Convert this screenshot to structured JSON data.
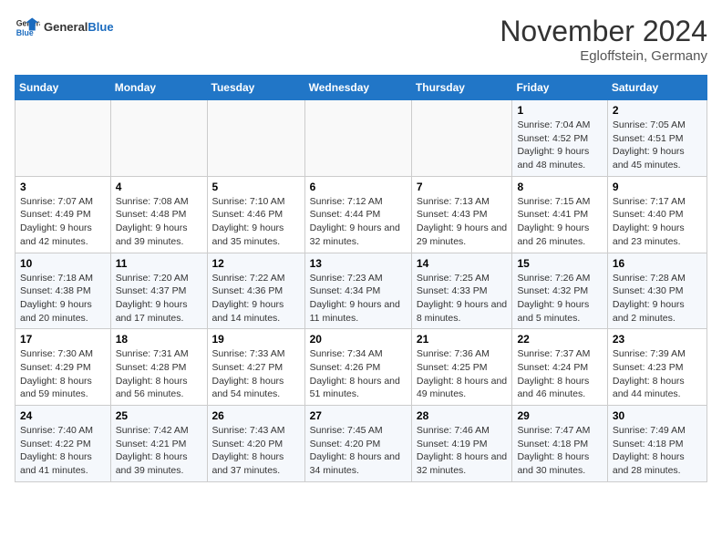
{
  "header": {
    "logo_general": "General",
    "logo_blue": "Blue",
    "month_year": "November 2024",
    "location": "Egloffstein, Germany"
  },
  "weekdays": [
    "Sunday",
    "Monday",
    "Tuesday",
    "Wednesday",
    "Thursday",
    "Friday",
    "Saturday"
  ],
  "weeks": [
    [
      {
        "day": "",
        "sunrise": "",
        "sunset": "",
        "daylight": ""
      },
      {
        "day": "",
        "sunrise": "",
        "sunset": "",
        "daylight": ""
      },
      {
        "day": "",
        "sunrise": "",
        "sunset": "",
        "daylight": ""
      },
      {
        "day": "",
        "sunrise": "",
        "sunset": "",
        "daylight": ""
      },
      {
        "day": "",
        "sunrise": "",
        "sunset": "",
        "daylight": ""
      },
      {
        "day": "1",
        "sunrise": "Sunrise: 7:04 AM",
        "sunset": "Sunset: 4:52 PM",
        "daylight": "Daylight: 9 hours and 48 minutes."
      },
      {
        "day": "2",
        "sunrise": "Sunrise: 7:05 AM",
        "sunset": "Sunset: 4:51 PM",
        "daylight": "Daylight: 9 hours and 45 minutes."
      }
    ],
    [
      {
        "day": "3",
        "sunrise": "Sunrise: 7:07 AM",
        "sunset": "Sunset: 4:49 PM",
        "daylight": "Daylight: 9 hours and 42 minutes."
      },
      {
        "day": "4",
        "sunrise": "Sunrise: 7:08 AM",
        "sunset": "Sunset: 4:48 PM",
        "daylight": "Daylight: 9 hours and 39 minutes."
      },
      {
        "day": "5",
        "sunrise": "Sunrise: 7:10 AM",
        "sunset": "Sunset: 4:46 PM",
        "daylight": "Daylight: 9 hours and 35 minutes."
      },
      {
        "day": "6",
        "sunrise": "Sunrise: 7:12 AM",
        "sunset": "Sunset: 4:44 PM",
        "daylight": "Daylight: 9 hours and 32 minutes."
      },
      {
        "day": "7",
        "sunrise": "Sunrise: 7:13 AM",
        "sunset": "Sunset: 4:43 PM",
        "daylight": "Daylight: 9 hours and 29 minutes."
      },
      {
        "day": "8",
        "sunrise": "Sunrise: 7:15 AM",
        "sunset": "Sunset: 4:41 PM",
        "daylight": "Daylight: 9 hours and 26 minutes."
      },
      {
        "day": "9",
        "sunrise": "Sunrise: 7:17 AM",
        "sunset": "Sunset: 4:40 PM",
        "daylight": "Daylight: 9 hours and 23 minutes."
      }
    ],
    [
      {
        "day": "10",
        "sunrise": "Sunrise: 7:18 AM",
        "sunset": "Sunset: 4:38 PM",
        "daylight": "Daylight: 9 hours and 20 minutes."
      },
      {
        "day": "11",
        "sunrise": "Sunrise: 7:20 AM",
        "sunset": "Sunset: 4:37 PM",
        "daylight": "Daylight: 9 hours and 17 minutes."
      },
      {
        "day": "12",
        "sunrise": "Sunrise: 7:22 AM",
        "sunset": "Sunset: 4:36 PM",
        "daylight": "Daylight: 9 hours and 14 minutes."
      },
      {
        "day": "13",
        "sunrise": "Sunrise: 7:23 AM",
        "sunset": "Sunset: 4:34 PM",
        "daylight": "Daylight: 9 hours and 11 minutes."
      },
      {
        "day": "14",
        "sunrise": "Sunrise: 7:25 AM",
        "sunset": "Sunset: 4:33 PM",
        "daylight": "Daylight: 9 hours and 8 minutes."
      },
      {
        "day": "15",
        "sunrise": "Sunrise: 7:26 AM",
        "sunset": "Sunset: 4:32 PM",
        "daylight": "Daylight: 9 hours and 5 minutes."
      },
      {
        "day": "16",
        "sunrise": "Sunrise: 7:28 AM",
        "sunset": "Sunset: 4:30 PM",
        "daylight": "Daylight: 9 hours and 2 minutes."
      }
    ],
    [
      {
        "day": "17",
        "sunrise": "Sunrise: 7:30 AM",
        "sunset": "Sunset: 4:29 PM",
        "daylight": "Daylight: 8 hours and 59 minutes."
      },
      {
        "day": "18",
        "sunrise": "Sunrise: 7:31 AM",
        "sunset": "Sunset: 4:28 PM",
        "daylight": "Daylight: 8 hours and 56 minutes."
      },
      {
        "day": "19",
        "sunrise": "Sunrise: 7:33 AM",
        "sunset": "Sunset: 4:27 PM",
        "daylight": "Daylight: 8 hours and 54 minutes."
      },
      {
        "day": "20",
        "sunrise": "Sunrise: 7:34 AM",
        "sunset": "Sunset: 4:26 PM",
        "daylight": "Daylight: 8 hours and 51 minutes."
      },
      {
        "day": "21",
        "sunrise": "Sunrise: 7:36 AM",
        "sunset": "Sunset: 4:25 PM",
        "daylight": "Daylight: 8 hours and 49 minutes."
      },
      {
        "day": "22",
        "sunrise": "Sunrise: 7:37 AM",
        "sunset": "Sunset: 4:24 PM",
        "daylight": "Daylight: 8 hours and 46 minutes."
      },
      {
        "day": "23",
        "sunrise": "Sunrise: 7:39 AM",
        "sunset": "Sunset: 4:23 PM",
        "daylight": "Daylight: 8 hours and 44 minutes."
      }
    ],
    [
      {
        "day": "24",
        "sunrise": "Sunrise: 7:40 AM",
        "sunset": "Sunset: 4:22 PM",
        "daylight": "Daylight: 8 hours and 41 minutes."
      },
      {
        "day": "25",
        "sunrise": "Sunrise: 7:42 AM",
        "sunset": "Sunset: 4:21 PM",
        "daylight": "Daylight: 8 hours and 39 minutes."
      },
      {
        "day": "26",
        "sunrise": "Sunrise: 7:43 AM",
        "sunset": "Sunset: 4:20 PM",
        "daylight": "Daylight: 8 hours and 37 minutes."
      },
      {
        "day": "27",
        "sunrise": "Sunrise: 7:45 AM",
        "sunset": "Sunset: 4:20 PM",
        "daylight": "Daylight: 8 hours and 34 minutes."
      },
      {
        "day": "28",
        "sunrise": "Sunrise: 7:46 AM",
        "sunset": "Sunset: 4:19 PM",
        "daylight": "Daylight: 8 hours and 32 minutes."
      },
      {
        "day": "29",
        "sunrise": "Sunrise: 7:47 AM",
        "sunset": "Sunset: 4:18 PM",
        "daylight": "Daylight: 8 hours and 30 minutes."
      },
      {
        "day": "30",
        "sunrise": "Sunrise: 7:49 AM",
        "sunset": "Sunset: 4:18 PM",
        "daylight": "Daylight: 8 hours and 28 minutes."
      }
    ]
  ]
}
